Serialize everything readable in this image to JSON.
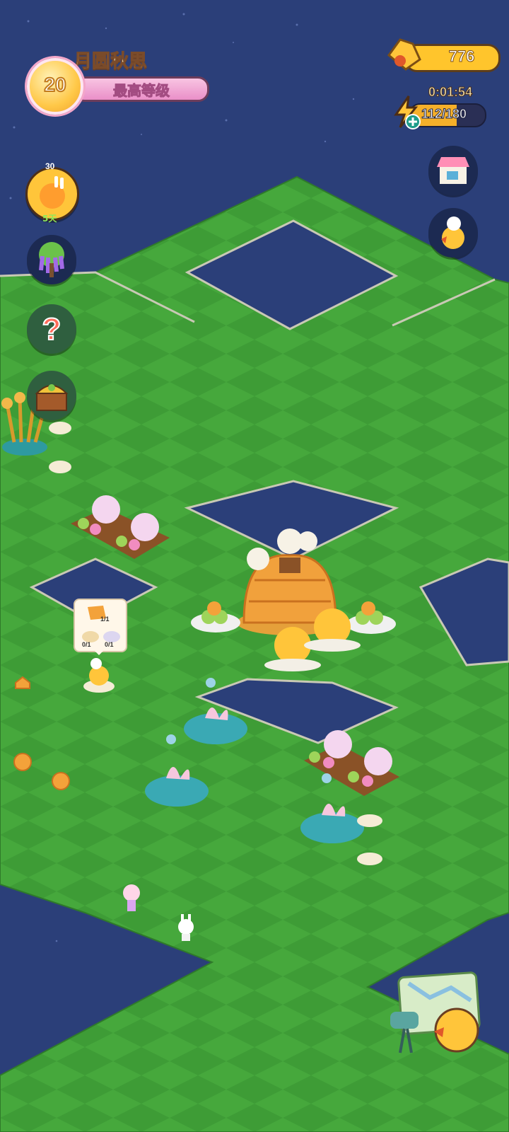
{
  "hud": {
    "event_title": "月圆秋思",
    "level": "20",
    "level_status": "最高等级",
    "coins": "776",
    "energy_timer": "0:01:54",
    "energy": "112/180",
    "energy_fraction": 0.62
  },
  "left_buttons": [
    {
      "name": "season-event-button",
      "icon": "duck-bunny-icon",
      "badge": "30",
      "days": "5天"
    },
    {
      "name": "wisteria-event-button",
      "icon": "wisteria-tree-icon"
    },
    {
      "name": "help-button",
      "icon": "question-mark-icon"
    },
    {
      "name": "treasure-chest-button",
      "icon": "chest-icon"
    }
  ],
  "right_buttons": [
    {
      "name": "shop-button",
      "icon": "shop-icon"
    },
    {
      "name": "chef-duck-button",
      "icon": "chef-duck-icon"
    }
  ],
  "order": {
    "counts": [
      "1/1",
      "0/1",
      "0/1"
    ]
  },
  "bottom_right": {
    "name": "map-button",
    "icon": "map-camera-duck-icon"
  },
  "colors": {
    "water": "#2b3f79",
    "grass": "#46a83c",
    "grass_dark": "#3a9334",
    "coin": "#ffc52c",
    "pink": "#ea8fc8"
  }
}
